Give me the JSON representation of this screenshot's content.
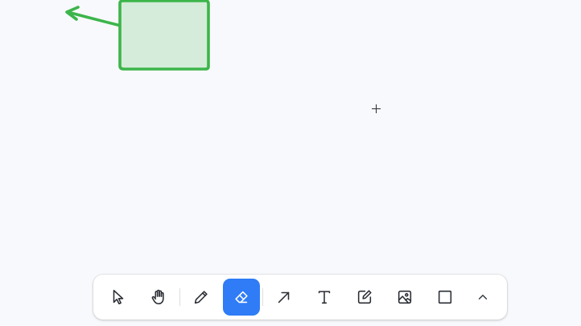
{
  "canvas": {
    "background": "#f8f9fc",
    "shape_stroke": "#3cb54a",
    "shape_fill": "#d4ecd9"
  },
  "toolbar": {
    "active_tool": "eraser",
    "active_color": "#2f7cf6",
    "tools": [
      {
        "id": "select",
        "icon": "pointer-icon"
      },
      {
        "id": "hand",
        "icon": "hand-icon"
      },
      {
        "id": "draw",
        "icon": "pencil-icon"
      },
      {
        "id": "eraser",
        "icon": "eraser-icon"
      },
      {
        "id": "arrow",
        "icon": "arrow-icon"
      },
      {
        "id": "text",
        "icon": "text-icon"
      },
      {
        "id": "note",
        "icon": "note-icon"
      },
      {
        "id": "media",
        "icon": "image-icon"
      },
      {
        "id": "rectangle",
        "icon": "rectangle-icon"
      },
      {
        "id": "more",
        "icon": "chevron-up-icon"
      }
    ]
  }
}
